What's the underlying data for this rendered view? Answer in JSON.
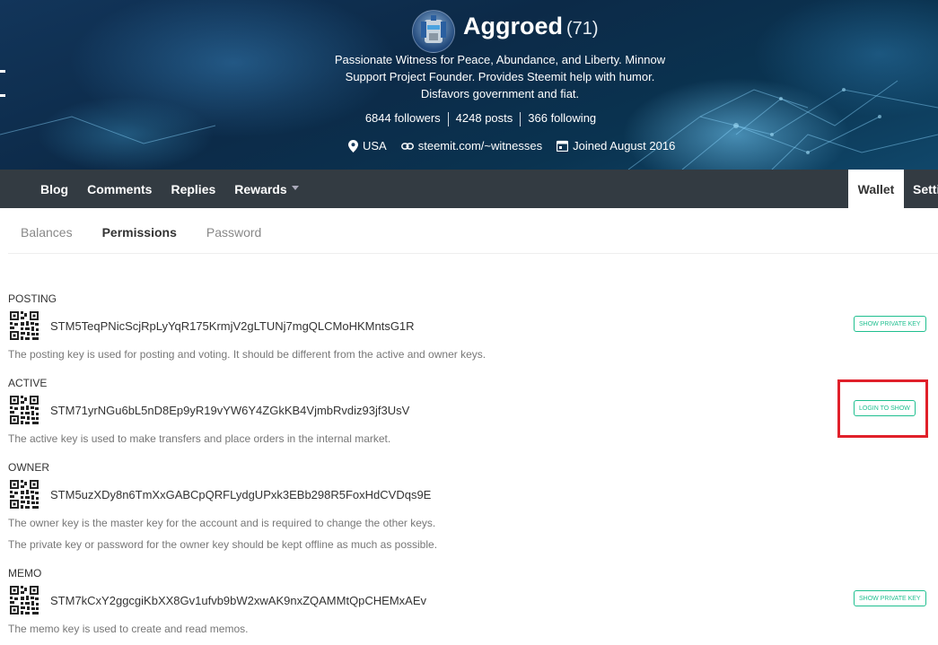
{
  "profile": {
    "name": "Aggroed",
    "reputation": "(71)",
    "about": "Passionate Witness for Peace, Abundance, and Liberty. Minnow Support Project Founder. Provides Steemit help with humor. Disfavors government and fiat.",
    "followers": "6844 followers",
    "posts": "4248 posts",
    "following": "366 following",
    "location": "USA",
    "website": "steemit.com/~witnesses",
    "joined": "Joined August 2016"
  },
  "nav": {
    "blog": "Blog",
    "comments": "Comments",
    "replies": "Replies",
    "rewards": "Rewards",
    "wallet": "Wallet",
    "settings": "Setti"
  },
  "subtabs": {
    "balances": "Balances",
    "permissions": "Permissions",
    "password": "Password"
  },
  "keys": {
    "posting": {
      "label": "POSTING",
      "value": "STM5TeqPNicScjRpLyYqR175KrmjV2gLTUNj7mgQLCMoHKMntsG1R",
      "desc": "The posting key is used for posting and voting. It should be different from the active and owner keys.",
      "button": "SHOW PRIVATE KEY"
    },
    "active": {
      "label": "ACTIVE",
      "value": "STM71yrNGu6bL5nD8Ep9yR19vYW6Y4ZGkKB4VjmbRvdiz93jf3UsV",
      "desc": "The active key is used to make transfers and place orders in the internal market.",
      "button": "LOGIN TO SHOW"
    },
    "owner": {
      "label": "OWNER",
      "value": "STM5uzXDy8n6TmXxGABCpQRFLydgUPxk3EBb298R5FoxHdCVDqs9E",
      "desc": "The owner key is the master key for the account and is required to change the other keys.",
      "desc2": "The private key or password for the owner key should be kept offline as much as possible."
    },
    "memo": {
      "label": "MEMO",
      "value": "STM7kCxY2ggcgiKbXX8Gv1ufvb9bW2xwAK9nxZQAMMtQpCHEMxAEv",
      "desc": "The memo key is used to create and read memos.",
      "button": "SHOW PRIVATE KEY"
    }
  },
  "colors": {
    "nav_bg": "#333b42",
    "accent": "#1fbf8f",
    "highlight": "#e0202a"
  },
  "icons": [
    "location-pin-icon",
    "link-icon",
    "calendar-icon",
    "qr-code-icon",
    "caret-down-icon"
  ]
}
